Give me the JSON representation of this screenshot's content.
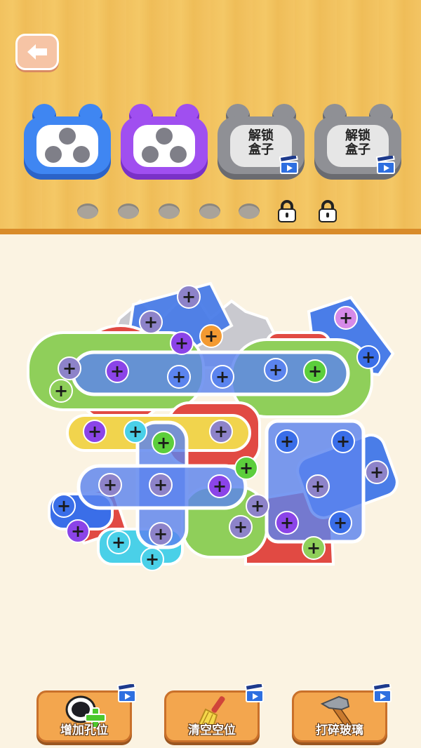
{
  "header": {
    "back_icon": "back-arrow-icon"
  },
  "boxes": [
    {
      "color": "#3f86f2",
      "state": "open"
    },
    {
      "color": "#a04ff0",
      "state": "open"
    },
    {
      "state": "locked",
      "label_line1": "解锁",
      "label_line2": "盒子",
      "icon": "video-clapper-icon"
    },
    {
      "state": "locked",
      "label_line1": "解锁",
      "label_line2": "盒子",
      "icon": "video-clapper-icon"
    }
  ],
  "slots": {
    "empty_count": 5,
    "locked_count": 2
  },
  "tools": [
    {
      "label": "增加孔位",
      "icon": "add-hole-icon"
    },
    {
      "label": "清空空位",
      "icon": "broom-icon"
    },
    {
      "label": "打碎玻璃",
      "icon": "hammer-icon"
    }
  ],
  "screw_symbol": "+"
}
